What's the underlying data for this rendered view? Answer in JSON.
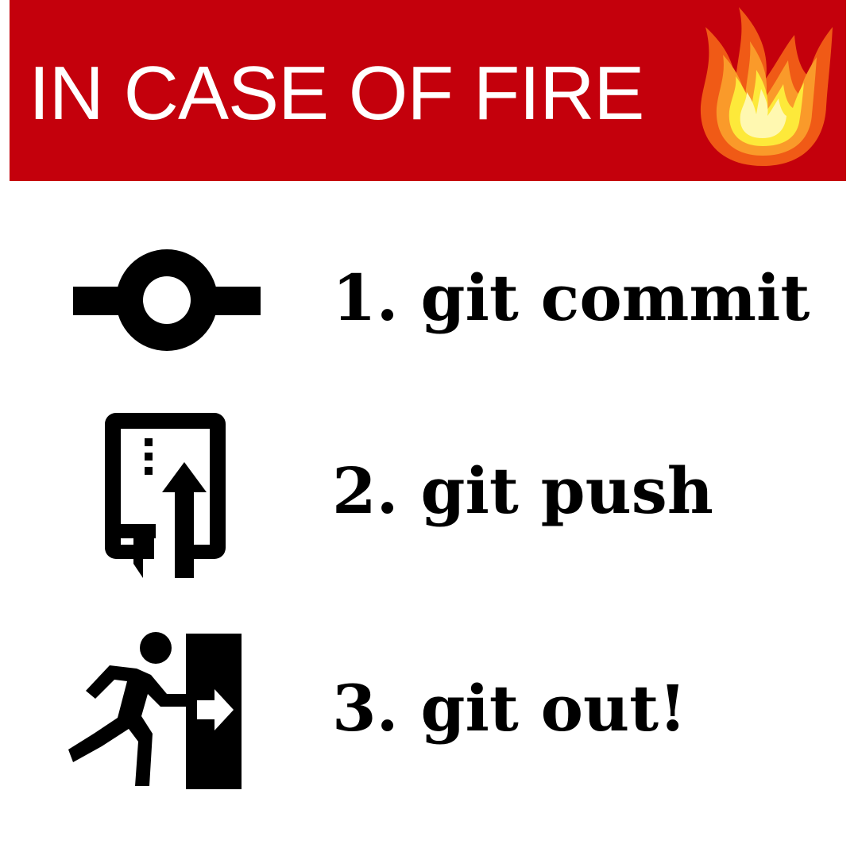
{
  "banner": {
    "title": "IN CASE OF FIRE",
    "icon": "fire-icon",
    "background_color": "#c4000c",
    "text_color": "#ffffff"
  },
  "steps": [
    {
      "number": "1.",
      "text": "git commit",
      "icon": "commit-icon"
    },
    {
      "number": "2.",
      "text": "git push",
      "icon": "elevator-up-icon"
    },
    {
      "number": "3.",
      "text": "git out!",
      "icon": "emergency-exit-icon"
    }
  ]
}
